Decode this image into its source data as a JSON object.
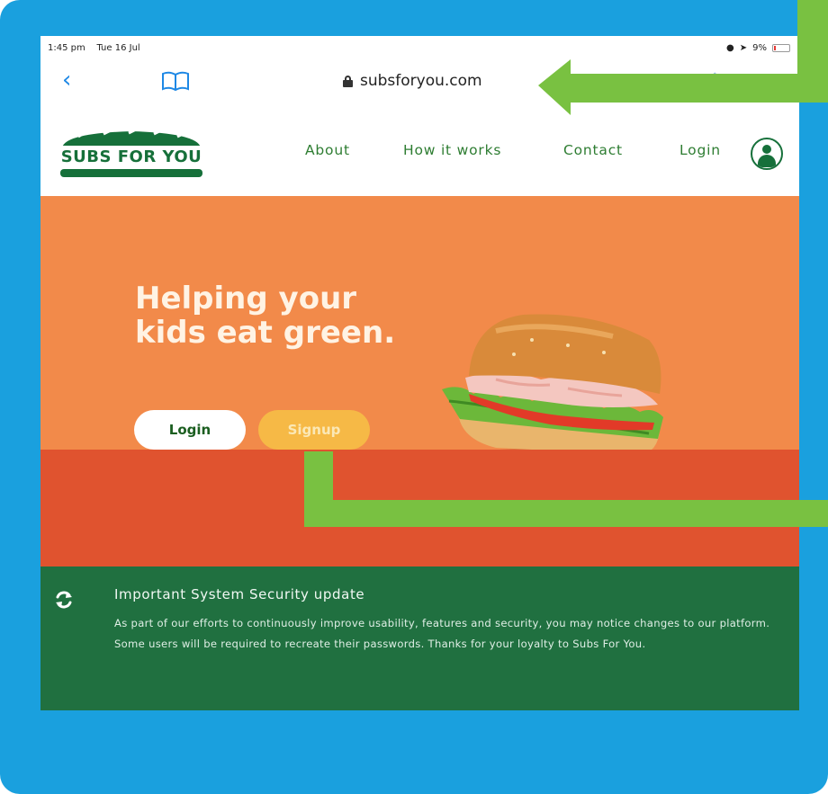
{
  "status_bar": {
    "time": "1:45 pm",
    "date": "Tue 16 Jul",
    "battery": "9%"
  },
  "browser": {
    "url": "subsforyou.com"
  },
  "site": {
    "logo_text": "SUBS FOR YOU",
    "nav": {
      "about": "About",
      "how_it_works": "How it works",
      "contact": "Contact",
      "login": "Login"
    }
  },
  "hero": {
    "title_line1": "Helping your",
    "title_line2": "kids eat green.",
    "login_button": "Login",
    "signup_button": "Signup"
  },
  "notice": {
    "title": "Important System Security update",
    "body": "As part of our efforts to continuously improve usability, features and security, you may notice changes to our platform. Some users will be required to recreate their passwords. Thanks for your loyalty to Subs For You."
  },
  "colors": {
    "frame_blue": "#1aa0de",
    "brand_green": "#16703a",
    "hero_orange": "#f28a4a",
    "band_red": "#e0532f",
    "notice_green": "#207040",
    "signup_yellow": "#f6b946",
    "arrow_green": "#79c141"
  },
  "icons": {
    "back": "chevron-left-icon",
    "bookmarks": "book-icon",
    "lock": "lock-icon",
    "account": "user-icon",
    "refresh": "refresh-icon",
    "annotation": "arrow-icon"
  }
}
